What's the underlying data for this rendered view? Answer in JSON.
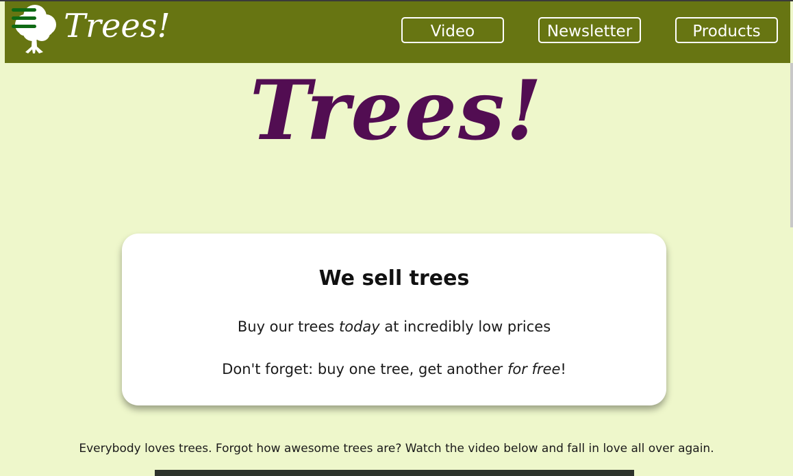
{
  "header": {
    "brand": "Trees!",
    "logo_icon": "tree-icon",
    "menu_icon": "hamburger-menu-icon",
    "nav": [
      {
        "label": "Video"
      },
      {
        "label": "Newsletter"
      },
      {
        "label": "Products"
      }
    ],
    "colors": {
      "navbar": "#677512",
      "menu_icon": "#0e6a14"
    }
  },
  "hero": {
    "title": "Trees!",
    "color": "#520d52"
  },
  "card": {
    "title": "We sell trees",
    "line1_before": "Buy our trees ",
    "line1_em": "today",
    "line1_after": " at incredibly low prices",
    "line2_before": "Don't forget: buy one tree, get another ",
    "line2_em": "for free",
    "line2_after": "!"
  },
  "intro": {
    "text": "Everybody loves trees. Forgot how awesome trees are? Watch the video below and fall in love all over again."
  },
  "page": {
    "background": "#eef7cb"
  }
}
